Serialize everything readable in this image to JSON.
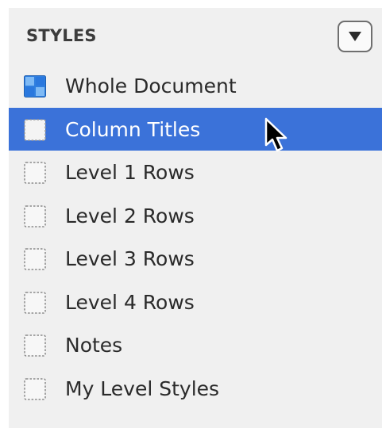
{
  "panel": {
    "title": "STYLES",
    "menu_icon": "triangle-down-icon"
  },
  "styles": [
    {
      "label": "Whole Document",
      "icon": "whole-document-style-icon",
      "selected": false
    },
    {
      "label": "Column Titles",
      "icon": "dashed-style-swatch-icon",
      "selected": true
    },
    {
      "label": "Level 1 Rows",
      "icon": "dashed-style-swatch-icon",
      "selected": false
    },
    {
      "label": "Level 2 Rows",
      "icon": "dashed-style-swatch-icon",
      "selected": false
    },
    {
      "label": "Level 3 Rows",
      "icon": "dashed-style-swatch-icon",
      "selected": false
    },
    {
      "label": "Level 4 Rows",
      "icon": "dashed-style-swatch-icon",
      "selected": false
    },
    {
      "label": "Notes",
      "icon": "dashed-style-swatch-icon",
      "selected": false
    },
    {
      "label": "My Level Styles",
      "icon": "dashed-style-swatch-icon",
      "selected": false
    }
  ],
  "colors": {
    "selection": "#3b72d9",
    "panel_background": "#f0f0f0",
    "whole_document_blue": "#2f7fe0"
  }
}
